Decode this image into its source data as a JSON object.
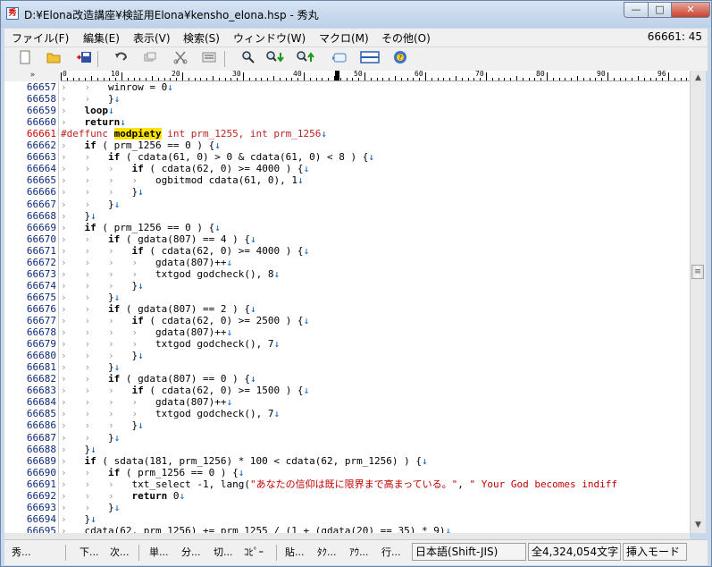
{
  "window": {
    "title": "D:¥Elona改造講座¥検証用Elona¥kensho_elona.hsp  - 秀丸",
    "min_label": "—",
    "max_label": "□",
    "close_label": "✕"
  },
  "menubar": {
    "items": [
      "ファイル(F)",
      "編集(E)",
      "表示(V)",
      "検索(S)",
      "ウィンドウ(W)",
      "マクロ(M)",
      "その他(O)"
    ],
    "position": "66661: 45"
  },
  "ruler": {
    "corner": "»",
    "labels": [
      "0",
      "10",
      "20",
      "30",
      "40",
      "50",
      "60",
      "70",
      "80",
      "90"
    ],
    "labels_96": "96"
  },
  "editor": {
    "lines": [
      {
        "n": "66657",
        "code": "[T][T]winrow = 0[E]"
      },
      {
        "n": "66658",
        "code": "[T][T]}[E]"
      },
      {
        "n": "66659",
        "code": "[T]loop[E]"
      },
      {
        "n": "66660",
        "code": "[T]return[E]"
      },
      {
        "n": "66661",
        "code": "#deffunc modpiety int prm_1255, int prm_1256[E]"
      },
      {
        "n": "66662",
        "code": "[T]if ( prm_1256 == 0 ) {[E]"
      },
      {
        "n": "66663",
        "code": "[T][T]if ( cdata(61, 0) > 0 & cdata(61, 0) < 8 ) {[E]"
      },
      {
        "n": "66664",
        "code": "[T][T][T]if ( cdata(62, 0) >= 4000 ) {[E]"
      },
      {
        "n": "66665",
        "code": "[T][T][T][T]ogbitmod cdata(61, 0), 1[E]"
      },
      {
        "n": "66666",
        "code": "[T][T][T]}[E]"
      },
      {
        "n": "66667",
        "code": "[T][T]}[E]"
      },
      {
        "n": "66668",
        "code": "[T]}[E]"
      },
      {
        "n": "66669",
        "code": "[T]if ( prm_1256 == 0 ) {[E]"
      },
      {
        "n": "66670",
        "code": "[T][T]if ( gdata(807) == 4 ) {[E]"
      },
      {
        "n": "66671",
        "code": "[T][T][T]if ( cdata(62, 0) >= 4000 ) {[E]"
      },
      {
        "n": "66672",
        "code": "[T][T][T][T]gdata(807)++[E]"
      },
      {
        "n": "66673",
        "code": "[T][T][T][T]txtgod godcheck(), 8[E]"
      },
      {
        "n": "66674",
        "code": "[T][T][T]}[E]"
      },
      {
        "n": "66675",
        "code": "[T][T]}[E]"
      },
      {
        "n": "66676",
        "code": "[T][T]if ( gdata(807) == 2 ) {[E]"
      },
      {
        "n": "66677",
        "code": "[T][T][T]if ( cdata(62, 0) >= 2500 ) {[E]"
      },
      {
        "n": "66678",
        "code": "[T][T][T][T]gdata(807)++[E]"
      },
      {
        "n": "66679",
        "code": "[T][T][T][T]txtgod godcheck(), 7[E]"
      },
      {
        "n": "66680",
        "code": "[T][T][T]}[E]"
      },
      {
        "n": "66681",
        "code": "[T][T]}[E]"
      },
      {
        "n": "66682",
        "code": "[T][T]if ( gdata(807) == 0 ) {[E]"
      },
      {
        "n": "66683",
        "code": "[T][T][T]if ( cdata(62, 0) >= 1500 ) {[E]"
      },
      {
        "n": "66684",
        "code": "[T][T][T][T]gdata(807)++[E]"
      },
      {
        "n": "66685",
        "code": "[T][T][T][T]txtgod godcheck(), 7[E]"
      },
      {
        "n": "66686",
        "code": "[T][T][T]}[E]"
      },
      {
        "n": "66687",
        "code": "[T][T]}[E]"
      },
      {
        "n": "66688",
        "code": "[T]}[E]"
      },
      {
        "n": "66689",
        "code": "[T]if ( sdata(181, prm_1256) * 100 < cdata(62, prm_1256) ) {[E]"
      },
      {
        "n": "66690",
        "code": "[T][T]if ( prm_1256 == 0 ) {[E]"
      },
      {
        "n": "66691",
        "code": "[T][T][T]txt_select -1, lang(\"あなたの信仰は既に限界まで高まっている。\", \" Your God becomes indiff"
      },
      {
        "n": "66692",
        "code": "[T][T][T]return 0[E]"
      },
      {
        "n": "66693",
        "code": "[T][T]}[E]"
      },
      {
        "n": "66694",
        "code": "[T]}[E]"
      },
      {
        "n": "66695",
        "code": "[T]cdata(62, prm_1256) += prm_1255 / (1 + (gdata(20) == 35) * 9)[E]"
      }
    ],
    "current_line": "66661",
    "highlight_word": "modpiety",
    "keywords": [
      "if",
      "return",
      "loop"
    ]
  },
  "statusbar": {
    "buttons": [
      "秀...",
      "下...",
      "次...",
      "単...",
      "分...",
      "切...",
      "ｺﾋﾟｰ",
      "貼...",
      "ﾀｸ...",
      "ｱｳ...",
      "行..."
    ],
    "encoding": "日本語(Shift-JIS)",
    "char_count": "全4,324,054文字",
    "mode": "挿入モード"
  }
}
